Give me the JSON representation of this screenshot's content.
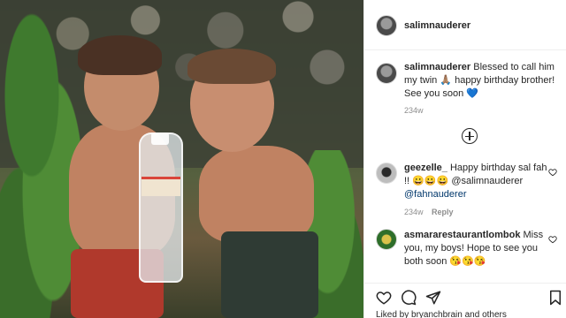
{
  "post": {
    "author": "salimnauderer",
    "caption_author": "salimnauderer",
    "caption_text": "Blessed to call him my twin 🙏🏽 happy birthday brother! See you soon 💙",
    "caption_time": "234w"
  },
  "comments": [
    {
      "user": "geezelle_",
      "text_line1": "Happy birthday sal fah",
      "text_line2": "!! 😀😀😀 @salimnauderer",
      "text_line3": "@fahnauderer",
      "time": "234w",
      "reply_label": "Reply"
    },
    {
      "user": "asmararestaurantlombok",
      "text_line1": "Miss",
      "text_line2": "you, my boys! Hope to see you",
      "text_line3": "both soon 😘😘😘",
      "time": "",
      "reply_label": ""
    }
  ],
  "likes_text": "Liked by bryanchbrain and others",
  "icons": {
    "load_more": "plus-circle-icon",
    "like": "heart-icon",
    "comment": "comment-icon",
    "share": "paper-plane-icon",
    "save": "bookmark-icon"
  }
}
